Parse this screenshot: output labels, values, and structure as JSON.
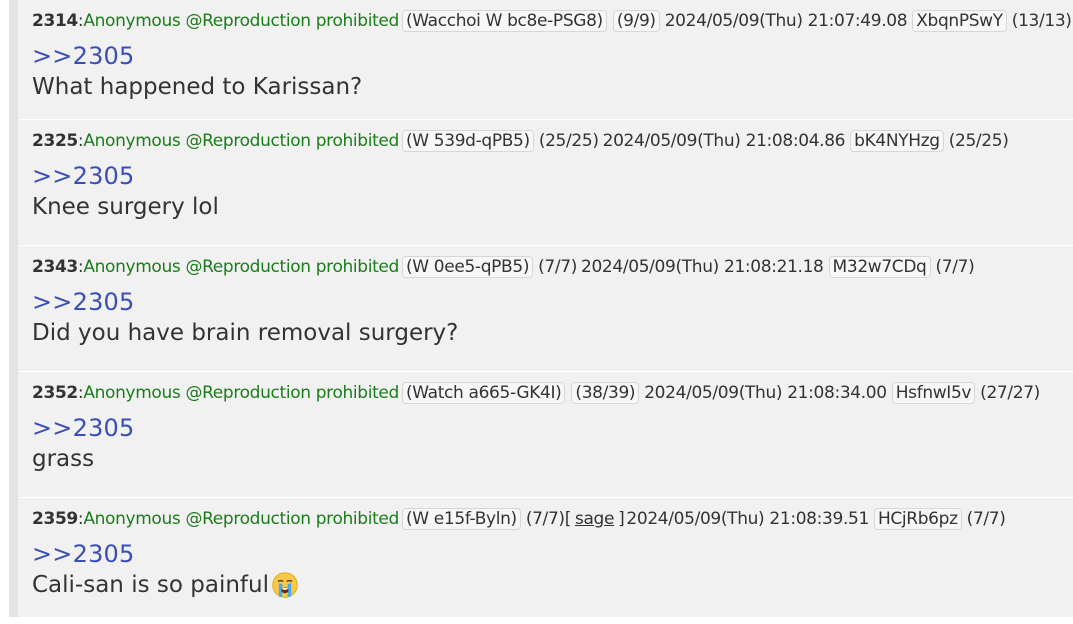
{
  "posts": [
    {
      "number": "2314",
      "name": "Anonymous @Reproduction prohibited",
      "id_tag": "(Wacchoi W bc8e-PSG8)",
      "count": "(9/9)",
      "sage": "",
      "datetime": "2024/05/09(Thu) 21:07:49.08",
      "user_id": "XbqnPSwY",
      "user_count": "(13/13)",
      "reply_to": ">>2305",
      "body": "What happened to Karissan?",
      "emoji": ""
    },
    {
      "number": "2325",
      "name": "Anonymous @Reproduction prohibited",
      "id_tag": "(W 539d-qPB5)",
      "count": "(25/25)",
      "sage": "",
      "datetime": "2024/05/09(Thu) 21:08:04.86",
      "user_id": "bK4NYHzg",
      "user_count": "(25/25)",
      "reply_to": ">>2305",
      "body": "Knee surgery lol",
      "emoji": ""
    },
    {
      "number": "2343",
      "name": "Anonymous @Reproduction prohibited",
      "id_tag": "(W 0ee5-qPB5)",
      "count": "(7/7)",
      "sage": "",
      "datetime": "2024/05/09(Thu) 21:08:21.18",
      "user_id": "M32w7CDq",
      "user_count": "(7/7)",
      "reply_to": ">>2305",
      "body": "Did you have brain removal surgery?",
      "emoji": ""
    },
    {
      "number": "2352",
      "name": "Anonymous @Reproduction prohibited",
      "id_tag": "(Watch a665-GK4I)",
      "count": "(38/39)",
      "sage": "",
      "datetime": "2024/05/09(Thu) 21:08:34.00",
      "user_id": "HsfnwI5v",
      "user_count": "(27/27)",
      "reply_to": ">>2305",
      "body": "grass",
      "emoji": ""
    },
    {
      "number": "2359",
      "name": "Anonymous @Reproduction prohibited",
      "id_tag": "(W e15f-Byln)",
      "count": "(7/7)",
      "sage": "sage",
      "datetime": "2024/05/09(Thu) 21:08:39.51",
      "user_id": "HCjRb6pz",
      "user_count": "(7/7)",
      "reply_to": ">>2305",
      "body": "Cali-san is so painful",
      "emoji": "loudly-crying-face-emoji"
    }
  ],
  "colors": {
    "name": "#1c7c1c",
    "reply_link": "#3b4eb8",
    "post_bg": "#f1f1f1",
    "text": "#333333"
  }
}
